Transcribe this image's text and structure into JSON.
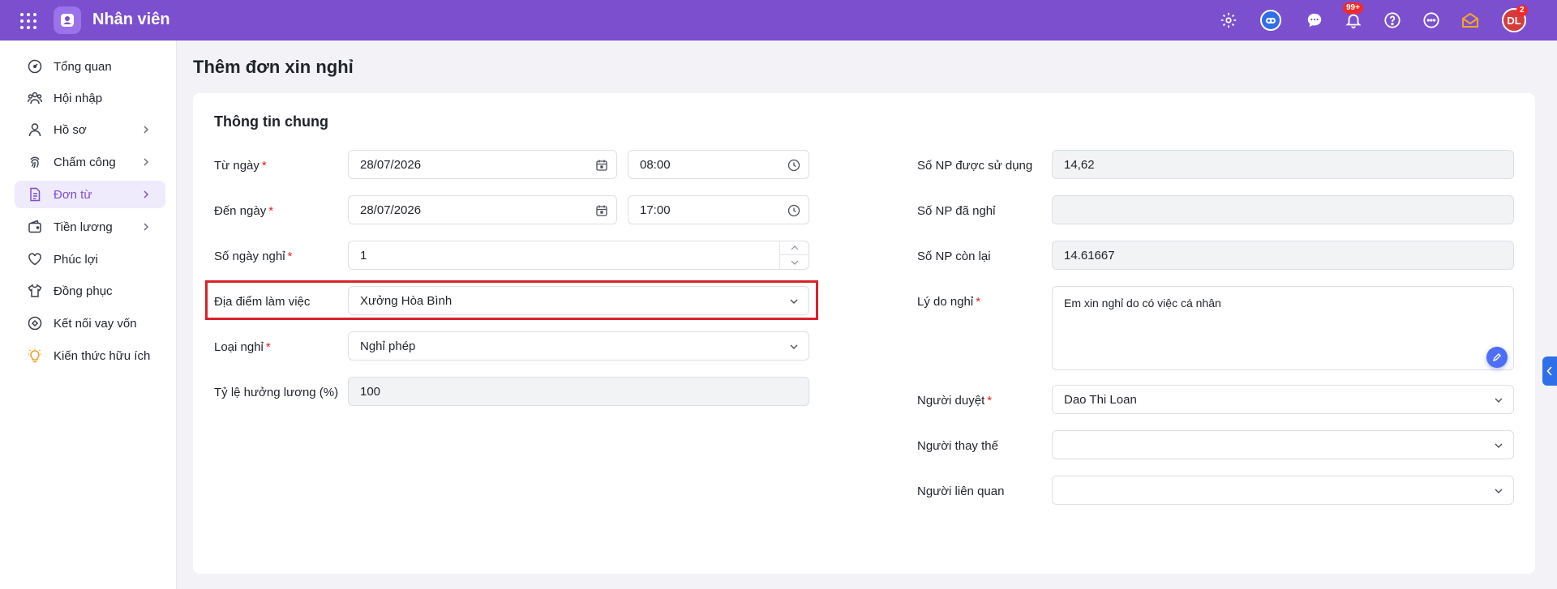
{
  "app": {
    "title": "Nhân viên"
  },
  "topbar": {
    "notifications_badge": "99+",
    "avatar_initials": "DL",
    "avatar_badge": "2"
  },
  "sidebar": {
    "items": [
      {
        "label": "Tổng quan",
        "icon": "dashboard-icon",
        "has_children": false,
        "active": false
      },
      {
        "label": "Hội nhập",
        "icon": "people-icon",
        "has_children": false,
        "active": false
      },
      {
        "label": "Hồ sơ",
        "icon": "user-icon",
        "has_children": true,
        "active": false
      },
      {
        "label": "Chấm công",
        "icon": "fingerprint-icon",
        "has_children": true,
        "active": false
      },
      {
        "label": "Đơn từ",
        "icon": "document-icon",
        "has_children": true,
        "active": true
      },
      {
        "label": "Tiền lương",
        "icon": "wallet-icon",
        "has_children": true,
        "active": false
      },
      {
        "label": "Phúc lợi",
        "icon": "heart-icon",
        "has_children": false,
        "active": false
      },
      {
        "label": "Đồng phục",
        "icon": "shirt-icon",
        "has_children": false,
        "active": false
      },
      {
        "label": "Kết nối vay vốn",
        "icon": "link-icon",
        "has_children": false,
        "active": false
      },
      {
        "label": "Kiến thức hữu ích",
        "icon": "lightbulb-icon",
        "has_children": false,
        "active": false
      }
    ]
  },
  "page": {
    "title": "Thêm đơn xin nghỉ",
    "section_title": "Thông tin chung"
  },
  "form": {
    "from_date": {
      "label": "Từ ngày",
      "date": "28/07/2026",
      "time": "08:00"
    },
    "to_date": {
      "label": "Đến ngày",
      "date": "28/07/2026",
      "time": "17:00"
    },
    "days_off": {
      "label": "Số ngày nghỉ",
      "value": "1"
    },
    "work_location": {
      "label": "Địa điểm làm việc",
      "value": "Xưởng Hòa Bình"
    },
    "leave_type": {
      "label": "Loại nghỉ",
      "value": "Nghỉ phép"
    },
    "salary_rate": {
      "label": "Tỷ lệ hưởng lương (%)",
      "value": "100"
    },
    "leave_used": {
      "label": "Số NP được sử dụng",
      "value": "14,62"
    },
    "leave_taken": {
      "label": "Số NP đã nghỉ",
      "value": ""
    },
    "leave_remaining": {
      "label": "Số NP còn lại",
      "value": "14.61667"
    },
    "reason": {
      "label": "Lý do nghỉ",
      "value": "Em xin nghỉ do có việc cá nhân"
    },
    "approver": {
      "label": "Người duyệt",
      "value": "Dao Thi Loan"
    },
    "substitute": {
      "label": "Người thay thế",
      "value": ""
    },
    "related": {
      "label": "Người liên quan",
      "value": ""
    }
  },
  "colors": {
    "brand": "#7b4fce",
    "required": "#e02020",
    "highlight": "#d9232b"
  }
}
